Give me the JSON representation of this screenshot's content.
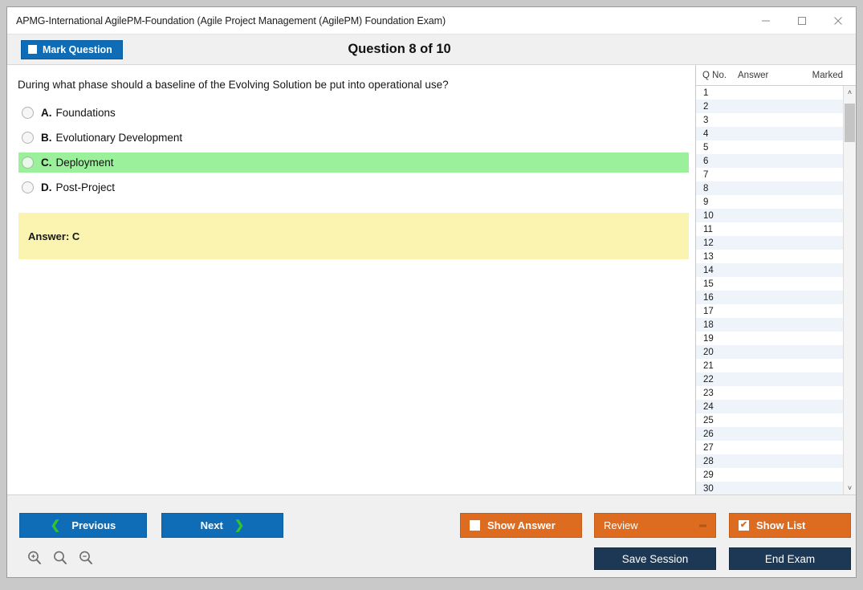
{
  "window": {
    "title": "APMG-International AgilePM-Foundation (Agile Project Management (AgilePM) Foundation Exam)",
    "minimize_label": "─",
    "maximize_label": "□",
    "close_label": "✕"
  },
  "header": {
    "mark_question_label": "Mark Question",
    "mark_question_checked": false,
    "question_counter": "Question 8 of 10"
  },
  "question": {
    "text": "During what phase should a baseline of the Evolving Solution be put into operational use?",
    "options": [
      {
        "letter": "A.",
        "text": "Foundations",
        "selected": false
      },
      {
        "letter": "B.",
        "text": "Evolutionary Development",
        "selected": false
      },
      {
        "letter": "C.",
        "text": "Deployment",
        "selected": true
      },
      {
        "letter": "D.",
        "text": "Post-Project",
        "selected": false
      }
    ],
    "answer_box": "Answer: C"
  },
  "list_panel": {
    "columns": [
      "Q No.",
      "Answer",
      "Marked"
    ],
    "rows": [
      {
        "no": "1",
        "answer": "",
        "marked": ""
      },
      {
        "no": "2",
        "answer": "",
        "marked": ""
      },
      {
        "no": "3",
        "answer": "",
        "marked": ""
      },
      {
        "no": "4",
        "answer": "",
        "marked": ""
      },
      {
        "no": "5",
        "answer": "",
        "marked": ""
      },
      {
        "no": "6",
        "answer": "",
        "marked": ""
      },
      {
        "no": "7",
        "answer": "",
        "marked": ""
      },
      {
        "no": "8",
        "answer": "",
        "marked": ""
      },
      {
        "no": "9",
        "answer": "",
        "marked": ""
      },
      {
        "no": "10",
        "answer": "",
        "marked": ""
      },
      {
        "no": "11",
        "answer": "",
        "marked": ""
      },
      {
        "no": "12",
        "answer": "",
        "marked": ""
      },
      {
        "no": "13",
        "answer": "",
        "marked": ""
      },
      {
        "no": "14",
        "answer": "",
        "marked": ""
      },
      {
        "no": "15",
        "answer": "",
        "marked": ""
      },
      {
        "no": "16",
        "answer": "",
        "marked": ""
      },
      {
        "no": "17",
        "answer": "",
        "marked": ""
      },
      {
        "no": "18",
        "answer": "",
        "marked": ""
      },
      {
        "no": "19",
        "answer": "",
        "marked": ""
      },
      {
        "no": "20",
        "answer": "",
        "marked": ""
      },
      {
        "no": "21",
        "answer": "",
        "marked": ""
      },
      {
        "no": "22",
        "answer": "",
        "marked": ""
      },
      {
        "no": "23",
        "answer": "",
        "marked": ""
      },
      {
        "no": "24",
        "answer": "",
        "marked": ""
      },
      {
        "no": "25",
        "answer": "",
        "marked": ""
      },
      {
        "no": "26",
        "answer": "",
        "marked": ""
      },
      {
        "no": "27",
        "answer": "",
        "marked": ""
      },
      {
        "no": "28",
        "answer": "",
        "marked": ""
      },
      {
        "no": "29",
        "answer": "",
        "marked": ""
      },
      {
        "no": "30",
        "answer": "",
        "marked": ""
      }
    ],
    "scroll_up_label": "˄",
    "scroll_down_label": "˅"
  },
  "footer": {
    "previous_label": "Previous",
    "previous_chevron": "❮",
    "next_label": "Next",
    "next_chevron": "❯",
    "show_answer_label": "Show Answer",
    "show_answer_checked": false,
    "review_label": "Review",
    "show_list_label": "Show List",
    "show_list_checked": true,
    "show_list_tick": "✔",
    "save_session_label": "Save Session",
    "end_exam_label": "End Exam",
    "zoom_in_icon": "zoom-in",
    "zoom_reset_icon": "zoom-reset",
    "zoom_out_icon": "zoom-out"
  },
  "colors": {
    "accent_blue": "#0f6cb6",
    "accent_orange": "#dd6b20",
    "navy": "#1d3855",
    "selected_green": "#9bf09b",
    "answer_yellow": "#fbf4b0",
    "chevron_green": "#2fc52f"
  }
}
